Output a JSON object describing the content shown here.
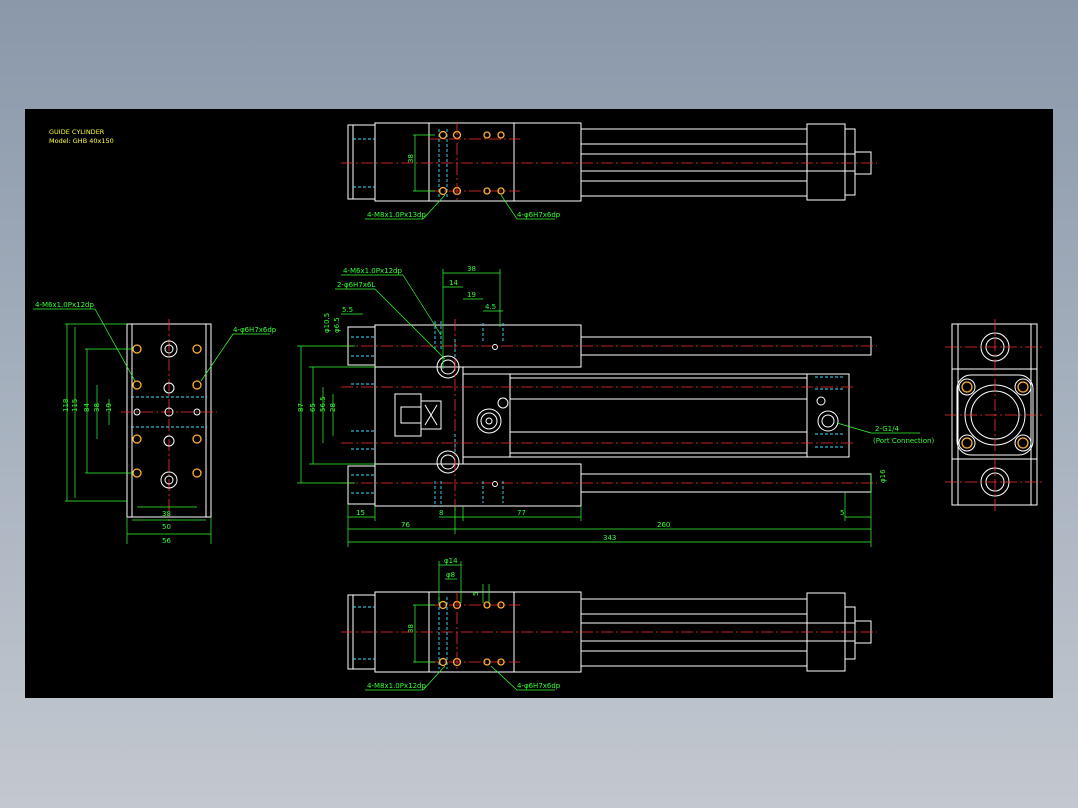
{
  "colors": {
    "outline": "#ffffff",
    "center": "#ff3030",
    "hidden": "#40e0ff",
    "dim": "#33ff33",
    "title": "#ffff33",
    "hole": "#ffb02e"
  },
  "title": {
    "line1": "GUIDE CYLINDER",
    "line2": "Model: GHB  40x150"
  },
  "callouts": {
    "top_left": "4-M8x1.0Px13dp",
    "top_right": "4-φ6H7x6dp",
    "bottom_left": "4-M8x1.0Px12dp",
    "bottom_right": "4-φ6H7x6dp",
    "left_tl": "4-M6x1.0Px12dp",
    "left_tr": "4-φ6H7x6dp",
    "main_m6": "4-M6x1.0Px12dp",
    "main_phi6": "2-φ6H7x6L",
    "port": "2-G1/4",
    "port_note": "(Port Connection)"
  },
  "dims": {
    "top_38": "38",
    "bot_38": "38",
    "bot_14": "φ14",
    "bot_8": "φ8",
    "bot_5": "5",
    "left_118": "118",
    "left_115": "115",
    "left_84": "84",
    "left_38v": "38",
    "left_19": "19",
    "left_38h": "38",
    "left_50": "50",
    "left_56": "56",
    "m_38": "38",
    "m_14": "14",
    "m_19": "19",
    "m_45": "4.5",
    "m_55": "5.5",
    "m_105": "φ10.5",
    "m_65": "φ6.5",
    "m_87": "87",
    "m_65v": "65",
    "m_565": "56.5",
    "m_28": "28",
    "m_15": "15",
    "m_76": "76",
    "m_8": "8",
    "m_77": "77",
    "m_5": "5",
    "m_260": "260",
    "m_343": "343",
    "m_phi16": "φ16"
  }
}
